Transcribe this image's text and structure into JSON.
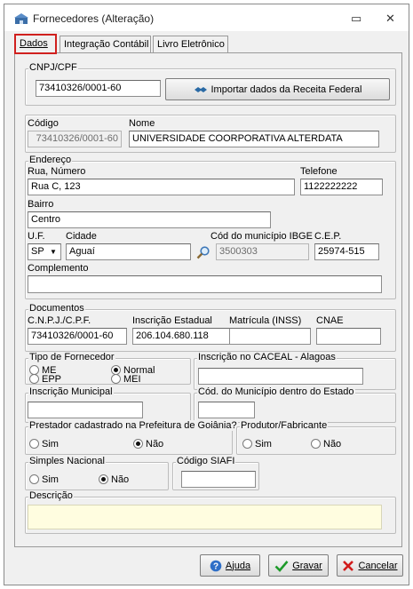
{
  "window": {
    "title": "Fornecedores (Alteração)",
    "minimize_glyph": "▭",
    "close_glyph": "✕"
  },
  "tabs": [
    {
      "label": "Dados"
    },
    {
      "label": "Integração Contábil"
    },
    {
      "label": "Livro Eletrônico"
    }
  ],
  "cnpj_group": {
    "legend": "CNPJ/CPF",
    "value": "73410326/0001-60",
    "import_button": "Importar dados da Receita Federal"
  },
  "ident": {
    "codigo_label": "Código",
    "codigo_value": "73410326/0001-60",
    "nome_label": "Nome",
    "nome_value": "UNIVERSIDADE COORPORATIVA ALTERDATA"
  },
  "endereco": {
    "legend": "Endereço",
    "rua_label": "Rua, Número",
    "rua_value": "Rua C, 123",
    "telefone_label": "Telefone",
    "telefone_value": "1122222222",
    "bairro_label": "Bairro",
    "bairro_value": "Centro",
    "uf_label": "U.F.",
    "uf_value": "SP",
    "cidade_label": "Cidade",
    "cidade_value": "Aguaí",
    "ibge_label": "Cód do município IBGE",
    "ibge_value": "3500303",
    "cep_label": "C.E.P.",
    "cep_value": "25974-515",
    "complemento_label": "Complemento",
    "complemento_value": ""
  },
  "documentos": {
    "legend": "Documentos",
    "cnpj_label": "C.N.P.J./C.P.F.",
    "cnpj_value": "73410326/0001-60",
    "ie_label": "Inscrição Estadual",
    "ie_value": "206.104.680.118",
    "matricula_label": "Matrícula (INSS)",
    "matricula_value": "",
    "cnae_label": "CNAE",
    "cnae_value": ""
  },
  "tipo_fornecedor": {
    "legend": "Tipo de Fornecedor",
    "options": [
      "ME",
      "EPP",
      "Normal",
      "MEI"
    ],
    "selected": "Normal"
  },
  "caceal": {
    "legend": "Inscrição no CACEAL - Alagoas",
    "value": ""
  },
  "insc_municipal": {
    "legend": "Inscrição Municipal",
    "value": ""
  },
  "cod_municipio_estado": {
    "legend": "Cód. do Município dentro do Estado",
    "value": ""
  },
  "prestador_goiania": {
    "legend": "Prestador cadastrado na Prefeitura de Goiânia?",
    "sim": "Sim",
    "nao": "Não",
    "selected": "Não"
  },
  "produtor": {
    "legend": "Produtor/Fabricante",
    "sim": "Sim",
    "nao": "Não",
    "selected": ""
  },
  "simples": {
    "legend": "Simples Nacional",
    "sim": "Sim",
    "nao": "Não",
    "selected": "Não"
  },
  "siafi": {
    "legend": "Código SIAFI",
    "value": ""
  },
  "descricao": {
    "legend": "Descrição",
    "value": ""
  },
  "footer": {
    "ajuda_label": "Ajuda",
    "gravar_label": "Gravar",
    "cancelar_label": "Cancelar"
  },
  "colors": {
    "active_tab_outline": "#d0201e",
    "description_bg": "#fffde0"
  }
}
